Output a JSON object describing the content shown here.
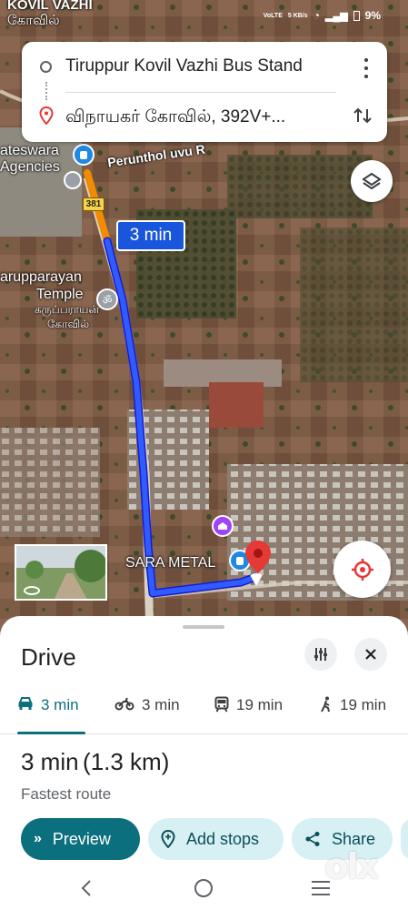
{
  "map": {
    "top_label_line1": "KOVIL VAZHI",
    "top_label_line2": "கோவில்",
    "agency_line1": "ateswara",
    "agency_line2": "Agencies",
    "road_name": "Perunthol uvu R",
    "road_shield": "381",
    "temple_line1": "arupparayan",
    "temple_line2": "Temple",
    "temple_tamil_line1": "கருப்பராயன்",
    "temple_tamil_line2": "கோவில்",
    "place_label": "SARA METAL",
    "route_time": "3 min"
  },
  "status": {
    "network": "VoLTE",
    "data_speed": "5 KB/s",
    "battery": "9%"
  },
  "route": {
    "origin": "Tiruppur Kovil Vazhi Bus Stand",
    "destination": "விநாயகர் கோவில், 392V+..."
  },
  "sheet": {
    "title": "Drive",
    "modes": [
      {
        "icon": "car-icon",
        "label": "3 min",
        "active": true
      },
      {
        "icon": "motorcycle-icon",
        "label": "3 min",
        "active": false
      },
      {
        "icon": "transit-icon",
        "label": "19 min",
        "active": false
      },
      {
        "icon": "walk-icon",
        "label": "19 min",
        "active": false
      }
    ],
    "duration": "3 min",
    "distance": "(1.3 km)",
    "subtitle": "Fastest route",
    "preview_label": "Preview",
    "add_stops_label": "Add stops",
    "share_label": "Share"
  },
  "watermark": "olx",
  "colors": {
    "accent": "#0b6f7d",
    "route_blue": "#1a40e0",
    "pin_red": "#e53935",
    "pill_bg": "#d7f0f4"
  }
}
